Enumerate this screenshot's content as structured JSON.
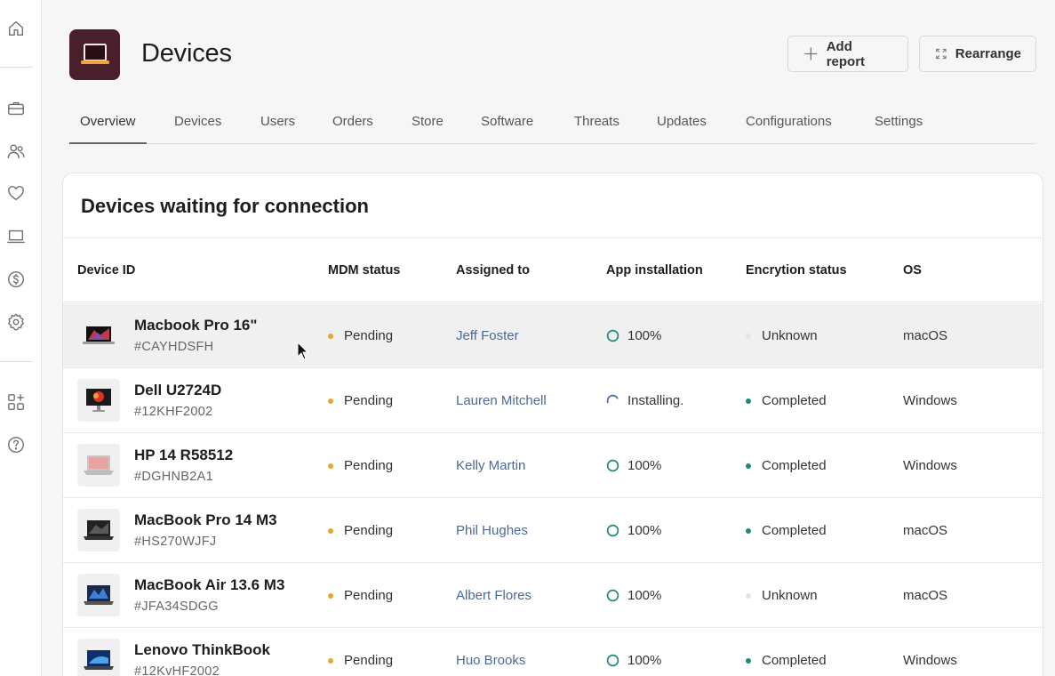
{
  "sidebar": {
    "icons": [
      "home-icon",
      "briefcase-icon",
      "users-icon",
      "heart-icon",
      "laptop-icon",
      "dollar-icon",
      "settings-icon",
      "apps-add-icon",
      "help-icon"
    ]
  },
  "header": {
    "title": "Devices",
    "add_report_label": "Add report",
    "rearrange_label": "Rearrange"
  },
  "tabs": [
    {
      "label": "Overview",
      "active": true
    },
    {
      "label": "Devices"
    },
    {
      "label": "Users"
    },
    {
      "label": "Orders"
    },
    {
      "label": "Store"
    },
    {
      "label": "Software"
    },
    {
      "label": "Threats"
    },
    {
      "label": "Updates"
    },
    {
      "label": "Configurations"
    },
    {
      "label": "Settings"
    }
  ],
  "card": {
    "title": "Devices waiting for connection",
    "columns": [
      "Device ID",
      "MDM status",
      "Assigned to",
      "App installation",
      "Encrytion status",
      "OS"
    ],
    "rows": [
      {
        "name": "Macbook Pro 16\"",
        "id": "#CAYHDSFH",
        "mdm": "Pending",
        "assigned": "Jeff Foster",
        "app": "100%",
        "app_state": "done",
        "encryption": "Unknown",
        "os": "macOS"
      },
      {
        "name": "Dell U2724D",
        "id": "#12KHF2002",
        "mdm": "Pending",
        "assigned": "Lauren Mitchell",
        "app": "Installing.",
        "app_state": "installing",
        "encryption": "Completed",
        "os": "Windows"
      },
      {
        "name": "HP 14 R58512",
        "id": "#DGHNB2A1",
        "mdm": "Pending",
        "assigned": "Kelly Martin",
        "app": "100%",
        "app_state": "done",
        "encryption": "Completed",
        "os": "Windows"
      },
      {
        "name": "MacBook Pro 14 M3",
        "id": "#HS270WJFJ",
        "mdm": "Pending",
        "assigned": "Phil Hughes",
        "app": "100%",
        "app_state": "done",
        "encryption": "Completed",
        "os": "macOS"
      },
      {
        "name": "MacBook Air 13.6 M3",
        "id": "#JFA34SDGG",
        "mdm": "Pending",
        "assigned": "Albert Flores",
        "app": "100%",
        "app_state": "done",
        "encryption": "Unknown",
        "os": "macOS"
      },
      {
        "name": "Lenovo ThinkBook",
        "id": "#12KvHF2002",
        "mdm": "Pending",
        "assigned": "Huo Brooks",
        "app": "100%",
        "app_state": "done",
        "encryption": "Completed",
        "os": "Windows"
      }
    ]
  },
  "colors": {
    "brand": "#4a1f2c",
    "pending": "#e7a823",
    "completed": "#1f8a78",
    "unknown": "#e3e3e3",
    "link": "#4a6a99",
    "progress": "#1f8a78"
  }
}
